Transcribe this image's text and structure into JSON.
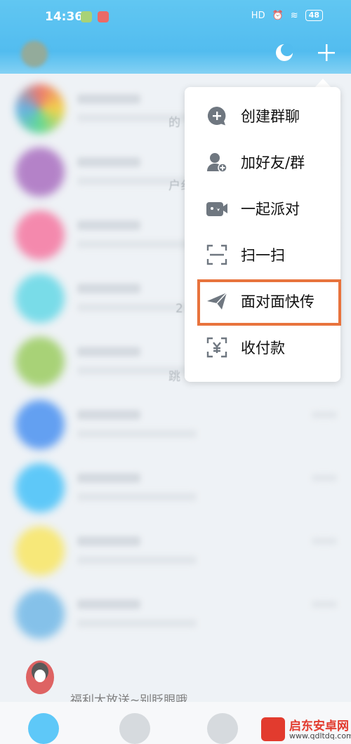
{
  "status_bar": {
    "time": "14:36",
    "battery": "48",
    "signal_label": "HD"
  },
  "menu": {
    "items": [
      {
        "label": "创建群聊",
        "icon": "create-group-icon"
      },
      {
        "label": "加好友/群",
        "icon": "add-friend-icon"
      },
      {
        "label": "一起派对",
        "icon": "party-icon"
      },
      {
        "label": "扫一扫",
        "icon": "scan-icon"
      },
      {
        "label": "面对面快传",
        "icon": "send-icon"
      },
      {
        "label": "收付款",
        "icon": "payment-icon"
      }
    ],
    "highlighted_index": 4
  },
  "chat_fragments": [
    "的",
    "户纟",
    "2",
    "跳"
  ],
  "ad": {
    "text": "福利大放送~别眨眼哦"
  },
  "watermark": {
    "title": "启东安卓网",
    "url": "www.qdltdq.com"
  },
  "colors": {
    "header_blue": "#19a6ea",
    "highlight": "#e8733d",
    "icon_gray": "#6f7780"
  }
}
